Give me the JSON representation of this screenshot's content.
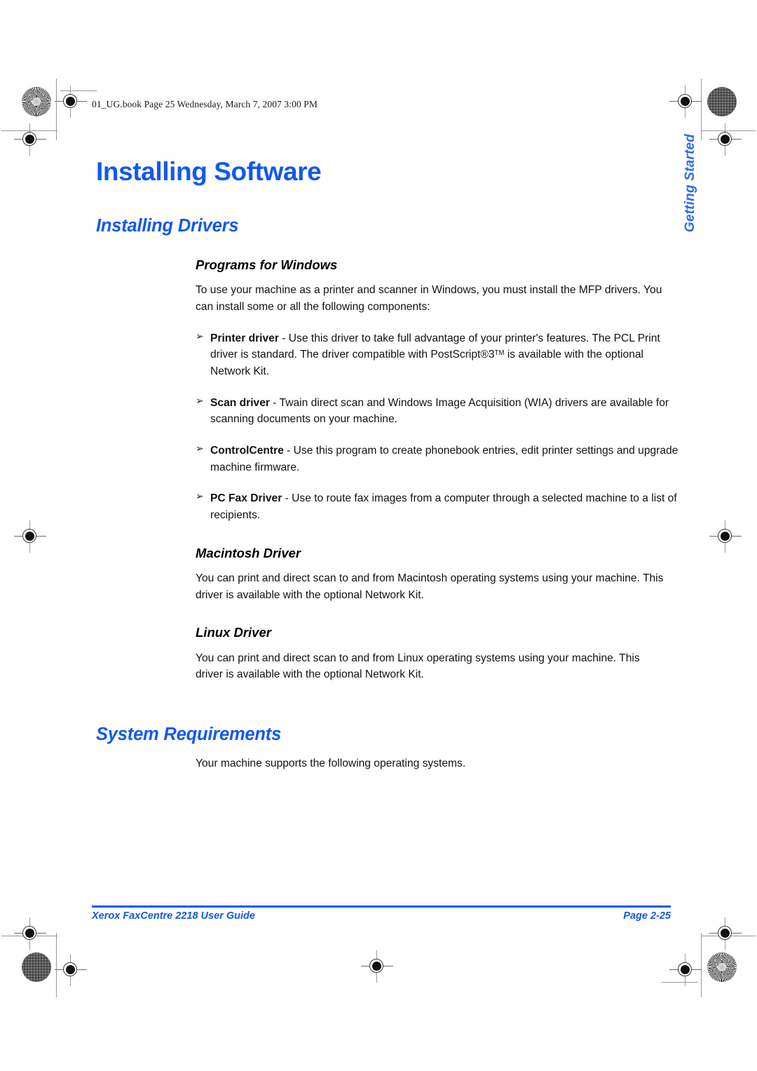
{
  "page": {
    "file_header": "01_UG.book  Page 25  Wednesday, March 7, 2007  3:00 PM",
    "side_tab": "Getting Started",
    "accent_color": "#1358ef",
    "body_color": "#111111"
  },
  "headings": {
    "chapter_title": "Installing Software",
    "section_installing_drivers": "Installing Drivers",
    "section_system_requirements": "System Requirements",
    "sub_programs_for_windows": "Programs for Windows",
    "sub_macintosh_driver": "Macintosh Driver",
    "sub_linux_driver": "Linux Driver"
  },
  "paragraphs": {
    "windows_intro": "To use your machine as a printer and scanner in Windows, you must install the MFP drivers. You can install some or all the following components:",
    "macintosh_body": "You can print and direct scan to and from Macintosh operating systems using your machine. This driver is available with the optional Network Kit.",
    "linux_body": "You can print and direct scan to and from Linux operating systems using your machine. This driver is available with the optional Network Kit.",
    "system_requirements_body": "Your machine supports the following operating systems."
  },
  "bullets": {
    "marker": "➢",
    "items": [
      {
        "term": "Printer driver",
        "text_before_sup": " - Use this driver to take full advantage of your printer's features. The PCL Print driver is standard. The driver compatible with PostScript®3",
        "sup": "TM",
        "text_after_sup": " is available with the optional Network Kit."
      },
      {
        "term": "Scan driver",
        "text_before_sup": " - Twain direct scan and Windows Image Acquisition (WIA) drivers are available for scanning documents on your machine.",
        "sup": "",
        "text_after_sup": ""
      },
      {
        "term": "ControlCentre",
        "text_before_sup": " - Use this program to create phonebook entries, edit printer settings and upgrade machine firmware.",
        "sup": "",
        "text_after_sup": ""
      },
      {
        "term": "PC Fax Driver",
        "text_before_sup": " - Use to route fax images from a computer through a selected machine to a list of recipients.",
        "sup": "",
        "text_after_sup": ""
      }
    ]
  },
  "footer": {
    "guide_title": "Xerox FaxCentre 2218 User Guide",
    "page_number": "Page 2-25"
  }
}
